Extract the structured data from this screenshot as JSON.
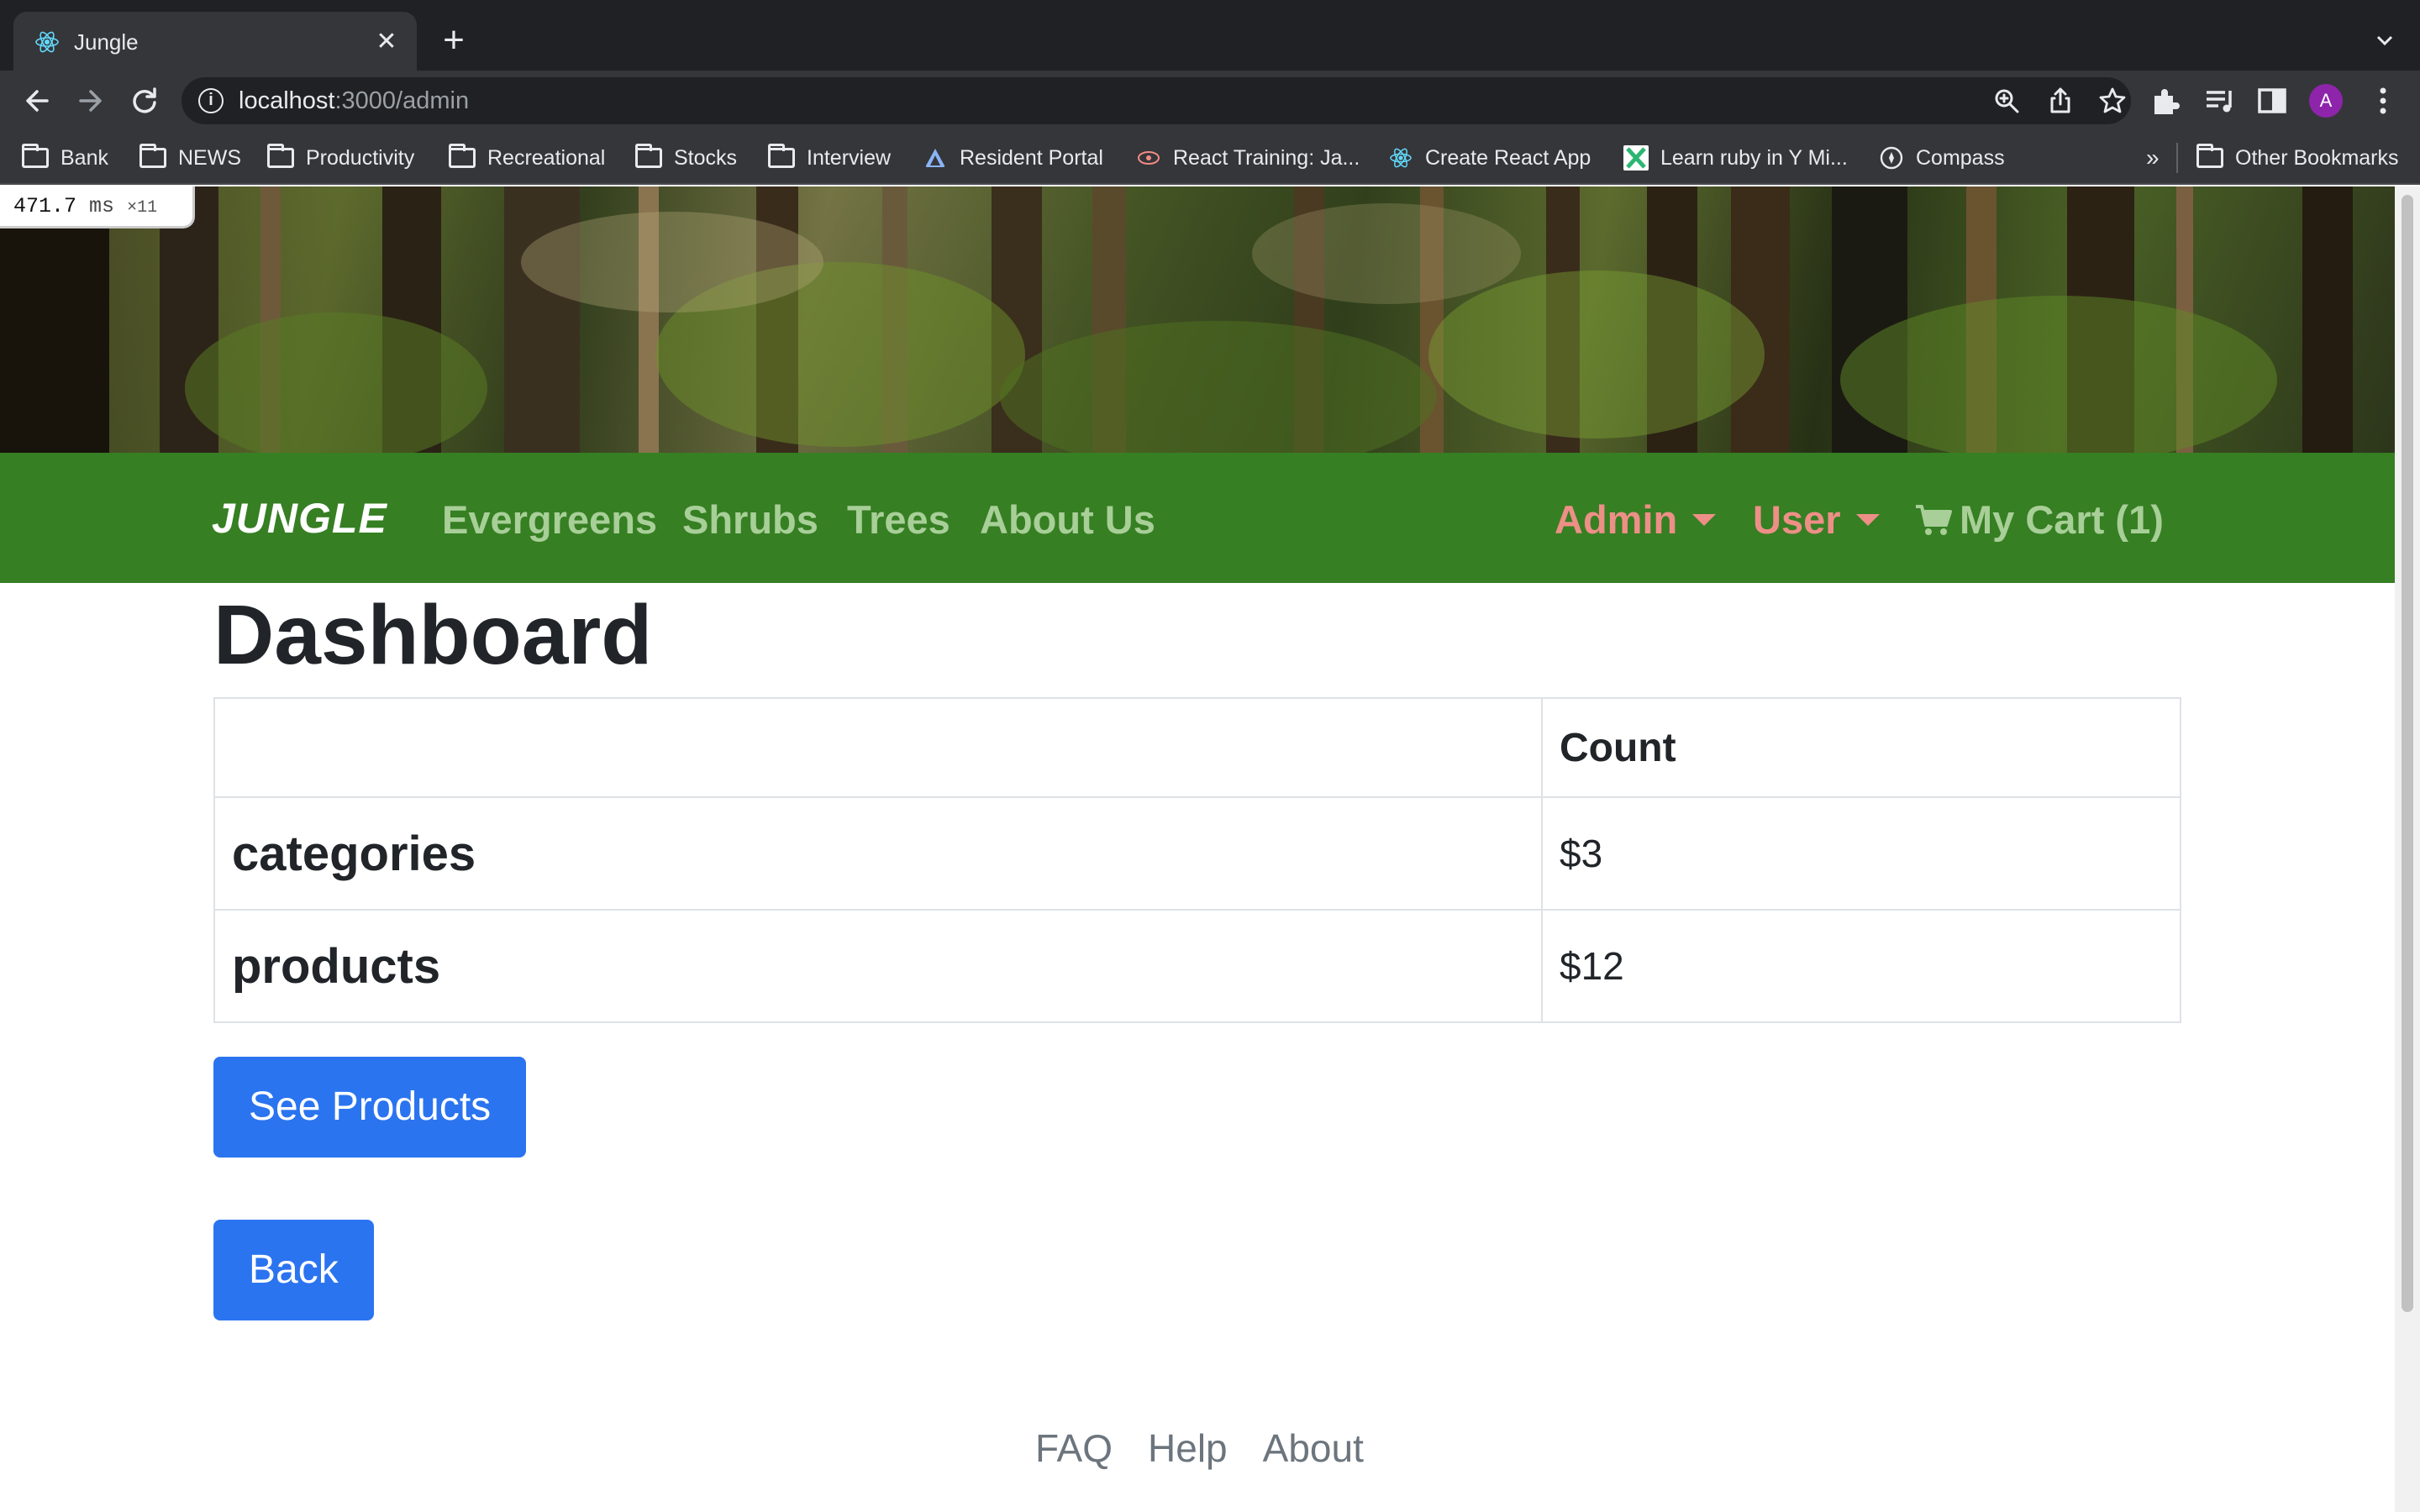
{
  "browser": {
    "tab_title": "Jungle",
    "tab_close": "✕",
    "new_tab": "+",
    "url_host": "localhost",
    "url_path": ":3000/admin",
    "bookmarks": [
      "Bank",
      "NEWS",
      "Productivity",
      "Recreational",
      "Stocks",
      "Interview",
      "Resident Portal",
      "React Training: Ja...",
      "Create React App",
      "Learn ruby in Y Mi...",
      "Compass"
    ],
    "bookmarks_overflow": "»",
    "other_bookmarks": "Other Bookmarks",
    "profile_initial": "A"
  },
  "perf": {
    "value": "471.7",
    "unit": "ms",
    "multiplier": "×11"
  },
  "nav": {
    "brand": "JUNGLE",
    "links": [
      "Evergreens",
      "Shrubs",
      "Trees",
      "About Us"
    ],
    "admin": "Admin",
    "user": "User",
    "cart": "My Cart (1)"
  },
  "page": {
    "title": "Dashboard",
    "table": {
      "header_count": "Count",
      "rows": [
        {
          "label": "categories",
          "value": "$3"
        },
        {
          "label": "products",
          "value": "$12"
        }
      ]
    },
    "see_products": "See Products",
    "back": "Back"
  },
  "footer": {
    "links": [
      "FAQ",
      "Help",
      "About"
    ]
  },
  "colors": {
    "navbar": "#367f23",
    "nav_link": "#a8cf98",
    "nav_dropdown": "#ee8f87",
    "button": "#2b74f0"
  },
  "icons": [
    "react-favicon-icon",
    "back-arrow-icon",
    "forward-arrow-icon",
    "reload-icon",
    "info-icon",
    "zoom-icon",
    "share-icon",
    "star-icon",
    "extensions-icon",
    "media-icon",
    "sidepanel-icon",
    "menu-dots-icon",
    "folder-icon",
    "cart-icon",
    "caret-down-icon"
  ]
}
